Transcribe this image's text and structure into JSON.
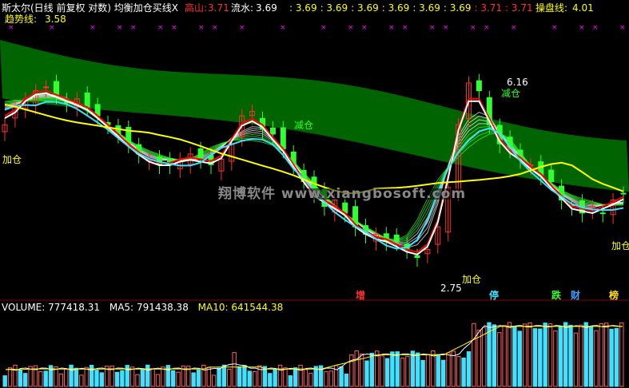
{
  "header": {
    "indicator_title": "斯太尔(日线 前复权 对数) 均衡加仓买线X",
    "gaoshan_label": "高山:",
    "gaoshan_value": "3.71",
    "liushui_label": "流水:",
    "liushui_value": "3.69",
    "line_values": [
      "3.69",
      "3.69",
      "3.69",
      "3.69",
      "3.69",
      "3.69",
      "3.71",
      "3.71"
    ],
    "caopan_label": "操盘线:",
    "caopan_value": "4.01",
    "trend_label": "趋势线:",
    "trend_value": "3.58"
  },
  "annotations": {
    "high_price": "6.16",
    "low_price": "2.75",
    "watermark": "翔博软件 www.xiangbosoft.com",
    "signals": {
      "add": "加仓",
      "reduce": "减仓"
    },
    "bottom_markers": [
      {
        "text": "增",
        "color": "#ff3030"
      },
      {
        "text": "停",
        "color": "#40e0ff"
      },
      {
        "text": "跌",
        "color": "#30ff30"
      },
      {
        "text": "财",
        "color": "#40a0ff"
      },
      {
        "text": "榜",
        "color": "#ffe000"
      }
    ]
  },
  "volume_header": {
    "volume_label": "VOLUME:",
    "volume_value": "777418.31",
    "ma5_label": "MA5:",
    "ma5_value": "791438.38",
    "ma10_label": "MA10:",
    "ma10_value": "641544.38"
  },
  "colors": {
    "up": "#ff3030",
    "down": "#30ff30",
    "cloud": "#006400",
    "gaoshan": "#ff0000",
    "liushui": "#ffffff",
    "trend_line": "#ffff00",
    "header_values": "#ffff00",
    "cross_marker": "#ff00ff",
    "volume_up": "#ff6060",
    "volume_down": "#40e0ff"
  },
  "chart_data": {
    "type": "candlestick",
    "title": "斯太尔(日线 前复权 对数)",
    "price_log_scale": true,
    "price_range": [
      2.5,
      7.5
    ],
    "series": [
      {
        "name": "高山",
        "value": 3.71
      },
      {
        "name": "流水",
        "value": 3.69
      },
      {
        "name": "操盘线",
        "value": 4.01
      },
      {
        "name": "趋势线",
        "value": 3.58
      }
    ],
    "close_path": [
      5.0,
      5.4,
      5.6,
      5.8,
      5.9,
      5.7,
      5.5,
      5.6,
      5.4,
      5.2,
      5.0,
      4.8,
      4.6,
      4.4,
      4.3,
      4.2,
      4.2,
      4.3,
      4.4,
      4.3,
      4.2,
      4.3,
      4.6,
      5.2,
      5.3,
      4.9,
      4.8,
      4.5,
      4.2,
      3.9,
      3.7,
      3.5,
      3.6,
      3.4,
      3.2,
      3.1,
      3.1,
      3.0,
      3.0,
      2.9,
      2.8,
      2.9,
      3.2,
      3.8,
      5.0,
      6.0,
      5.8,
      5.0,
      4.6,
      4.5,
      4.3,
      4.2,
      4.0,
      3.9,
      3.6,
      3.5,
      3.4,
      3.5,
      3.4,
      3.6,
      3.7
    ],
    "extremes": {
      "high": 6.16,
      "low": 2.75
    },
    "volume": {
      "last": 777418.31,
      "ma5": 791438.38,
      "ma10": 641544.38
    }
  }
}
